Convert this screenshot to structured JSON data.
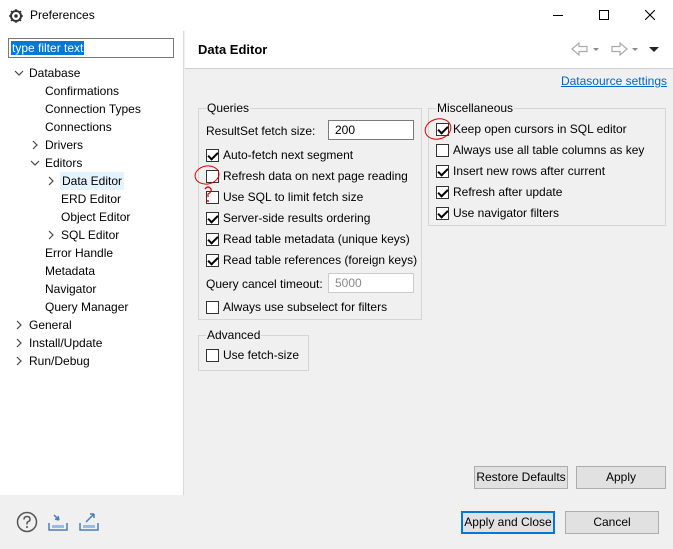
{
  "window": {
    "title": "Preferences"
  },
  "filter": {
    "placeholder": "type filter text"
  },
  "tree": [
    {
      "label": "Database",
      "expanded": true
    },
    {
      "label": "Confirmations"
    },
    {
      "label": "Connection Types"
    },
    {
      "label": "Connections"
    },
    {
      "label": "Drivers",
      "expanded": false
    },
    {
      "label": "Editors",
      "expanded": true
    },
    {
      "label": "Data Editor",
      "expanded": false,
      "selected": true
    },
    {
      "label": "ERD Editor"
    },
    {
      "label": "Object Editor"
    },
    {
      "label": "SQL Editor",
      "expanded": false
    },
    {
      "label": "Error Handle"
    },
    {
      "label": "Metadata"
    },
    {
      "label": "Navigator"
    },
    {
      "label": "Query Manager"
    },
    {
      "label": "General",
      "expanded": false
    },
    {
      "label": "Install/Update",
      "expanded": false
    },
    {
      "label": "Run/Debug",
      "expanded": false
    }
  ],
  "page": {
    "title": "Data Editor",
    "datasource_link": "Datasource settings"
  },
  "queries": {
    "title": "Queries",
    "fetch_size_label": "ResultSet fetch size:",
    "fetch_size_value": "200",
    "auto_fetch": {
      "label": "Auto-fetch next segment",
      "checked": true
    },
    "refresh_next_page": {
      "label": "Refresh data on next page reading",
      "checked": false
    },
    "use_sql_limit": {
      "label": "Use SQL to limit fetch size",
      "checked": false
    },
    "server_side_ordering": {
      "label": "Server-side results ordering",
      "checked": true
    },
    "read_metadata": {
      "label": "Read table metadata (unique keys)",
      "checked": true
    },
    "read_references": {
      "label": "Read table references (foreign keys)",
      "checked": true
    },
    "cancel_timeout_label": "Query cancel timeout:",
    "cancel_timeout_value": "5000",
    "always_subselect": {
      "label": "Always use subselect for filters",
      "checked": false
    }
  },
  "advanced": {
    "title": "Advanced",
    "use_fetch_size": {
      "label": "Use fetch-size",
      "checked": false
    }
  },
  "misc": {
    "title": "Miscellaneous",
    "keep_cursors": {
      "label": "Keep open cursors in SQL editor",
      "checked": true
    },
    "all_columns_key": {
      "label": "Always use all table columns as key",
      "checked": false
    },
    "insert_after_current": {
      "label": "Insert new rows after current",
      "checked": true
    },
    "refresh_after_update": {
      "label": "Refresh after update",
      "checked": true
    },
    "navigator_filters": {
      "label": "Use navigator filters",
      "checked": true
    }
  },
  "buttons": {
    "restore_defaults": "Restore Defaults",
    "apply": "Apply",
    "apply_and_close": "Apply and Close",
    "cancel": "Cancel"
  },
  "colors": {
    "accent": "#0078d7",
    "link": "#0066cc",
    "annotation": "#d40000"
  }
}
